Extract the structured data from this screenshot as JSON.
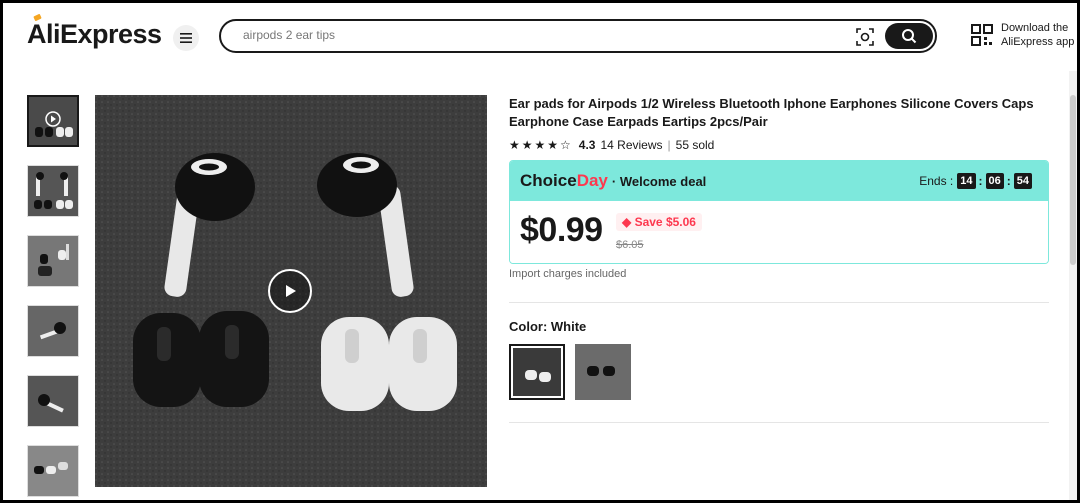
{
  "header": {
    "logo_text": "AliExpress",
    "search": {
      "value": "airpods 2 ear tips",
      "placeholder": ""
    },
    "download_line1": "Download the",
    "download_line2": "AliExpress app"
  },
  "gallery": {
    "thumb_count": 6,
    "selected_thumb": 0
  },
  "product": {
    "title": "Ear pads for Airpods 1/2 Wireless Bluetooth Iphone Earphones Silicone Covers Caps Earphone Case Earpads Eartips 2pcs/Pair",
    "rating": "4.3",
    "rating_value": 4.3,
    "reviews": "14 Reviews",
    "sold": "55 sold"
  },
  "deal": {
    "brand_choice": "Choice",
    "brand_day": "Day",
    "welcome": "Welcome deal",
    "ends_label": "Ends :",
    "hours": "14",
    "minutes": "06",
    "seconds": "54",
    "price": "$0.99",
    "save": "Save $5.06",
    "original": "$6.05"
  },
  "import_note": "Import charges included",
  "color": {
    "label": "Color: White",
    "options": [
      "White",
      "Black"
    ],
    "selected": "White"
  },
  "colors": {
    "brand_red": "#fd384f",
    "choice_teal": "#7de8dc",
    "accent_orange": "#f5a623"
  }
}
